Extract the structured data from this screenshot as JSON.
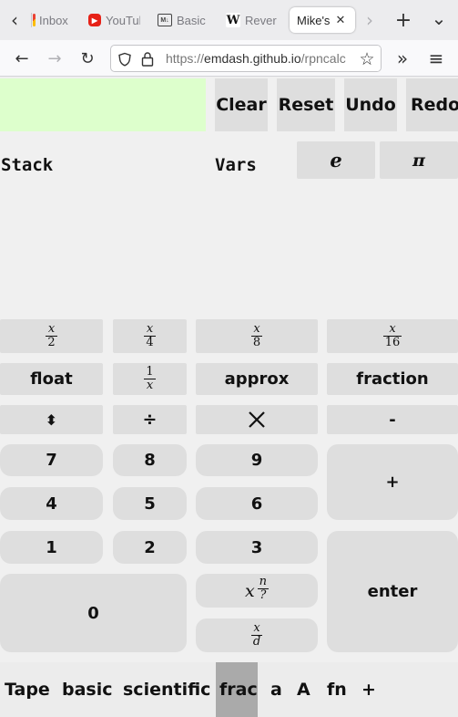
{
  "browser": {
    "tabs": [
      {
        "label": "Inbox",
        "icon": "gmail-icon",
        "active": false
      },
      {
        "label": "YouTube",
        "icon": "youtube-icon",
        "active": false
      },
      {
        "label": "Basic",
        "icon": "markdown-icon",
        "active": false
      },
      {
        "label": "Reverse",
        "icon": "wikipedia-icon",
        "active": false
      },
      {
        "label": "Mike's",
        "icon": "",
        "active": true
      }
    ],
    "url_prefix": "https://",
    "url_host": "emdash.github.io",
    "url_path": "/rpncalc",
    "icons": {
      "back": "‹",
      "forward_tabs": "›",
      "new_tab": "+",
      "list_tabs": "⌄",
      "close": "✕",
      "nav_back": "←",
      "nav_forward": "→",
      "reload": "↻",
      "bookmark": "☆",
      "overflow": "»",
      "menu": "≡"
    }
  },
  "calculator": {
    "input_value": "",
    "input_color": "#ddffcc",
    "top_buttons": {
      "clear": "Clear",
      "reset": "Reset",
      "undo": "Undo",
      "redo": "Redo"
    },
    "stack_label": "Stack",
    "vars_label": "Vars",
    "const_buttons": {
      "e": "e",
      "pi": "π"
    },
    "frac_row": [
      {
        "num": "x",
        "den": "2"
      },
      {
        "num": "x",
        "den": "4"
      },
      {
        "num": "x",
        "den": "8"
      },
      {
        "num": "x",
        "den": "16"
      }
    ],
    "mode_row": {
      "float": "float",
      "recip_num": "1",
      "recip_den": "x",
      "approx": "approx",
      "fraction": "fraction"
    },
    "ops": {
      "swap": "⬍",
      "divide": "÷",
      "multiply": "✕",
      "subtract": "-",
      "add": "+",
      "enter": "enter"
    },
    "digits": {
      "d7": "7",
      "d8": "8",
      "d9": "9",
      "d4": "4",
      "d5": "5",
      "d6": "6",
      "d1": "1",
      "d2": "2",
      "d3": "3",
      "d0": "0"
    },
    "special": {
      "pow_base": "x",
      "pow_num": "n",
      "pow_den": "?",
      "div_num": "x",
      "div_den": "d"
    }
  },
  "bottom_tabs": {
    "tape": "Tape",
    "basic": "basic",
    "scientific": "scientific",
    "frac": "frac",
    "a_lower": "a",
    "a_upper": "A",
    "fn": "fn",
    "plus": "+",
    "active": "frac"
  }
}
